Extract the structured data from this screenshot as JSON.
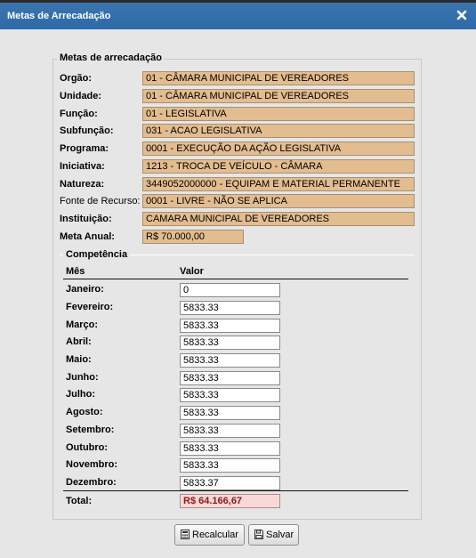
{
  "dialog": {
    "title": "Metas de Arrecadação"
  },
  "form": {
    "legend": "Metas de arrecadação",
    "fields": [
      {
        "label": "Orgão:",
        "value": "01 - CÂMARA MUNICIPAL DE VEREADORES"
      },
      {
        "label": "Unidade:",
        "value": "01 - CÂMARA MUNICIPAL DE VEREADORES"
      },
      {
        "label": "Função:",
        "value": "01 - LEGISLATIVA"
      },
      {
        "label": "Subfunção:",
        "value": "031 - ACAO LEGISLATIVA"
      },
      {
        "label": "Programa:",
        "value": "0001 - EXECUÇÃO DA AÇÃO LEGISLATIVA"
      },
      {
        "label": "Iniciativa:",
        "value": "1213 - TROCA DE VEÍCULO - CÂMARA"
      },
      {
        "label": "Natureza:",
        "value": "3449052000000 - EQUIPAM E MATERIAL PERMANENTE"
      },
      {
        "label": "Fonte de Recurso:",
        "value": "0001 - LIVRE - NÃO SE APLICA"
      },
      {
        "label": "Instituição:",
        "value": "CAMARA MUNICIPAL DE VEREADORES"
      }
    ],
    "meta_anual": {
      "label": "Meta Anual:",
      "value": "R$ 70.000,00"
    }
  },
  "competencia": {
    "legend": "Competência",
    "col_mes": "Mês",
    "col_valor": "Valor",
    "months": [
      {
        "label": "Janeiro:",
        "value": "0"
      },
      {
        "label": "Fevereiro:",
        "value": "5833.33"
      },
      {
        "label": "Março:",
        "value": "5833.33"
      },
      {
        "label": "Abril:",
        "value": "5833.33"
      },
      {
        "label": "Maio:",
        "value": "5833.33"
      },
      {
        "label": "Junho:",
        "value": "5833.33"
      },
      {
        "label": "Julho:",
        "value": "5833.33"
      },
      {
        "label": "Agosto:",
        "value": "5833.33"
      },
      {
        "label": "Setembro:",
        "value": "5833.33"
      },
      {
        "label": "Outubro:",
        "value": "5833.33"
      },
      {
        "label": "Novembro:",
        "value": "5833.33"
      },
      {
        "label": "Dezembro:",
        "value": "5833.37"
      }
    ],
    "total_label": "Total:",
    "total_value": "R$ 64.166,67"
  },
  "buttons": {
    "recalcular": "Recalcular",
    "salvar": "Salvar"
  },
  "icons": {
    "close": "close-icon",
    "recalcular": "calculator-icon",
    "salvar": "save-icon"
  },
  "colors": {
    "titlebar": "#3a75b0",
    "readonly_field": "#e3bc8f",
    "total_field": "#f9d8d8"
  }
}
